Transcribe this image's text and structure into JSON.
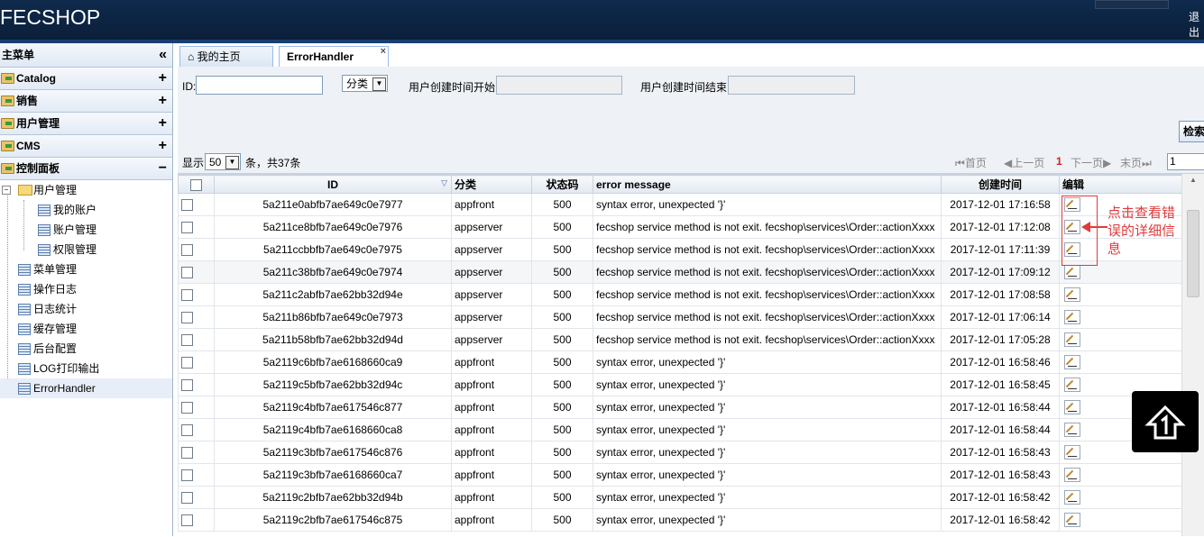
{
  "header": {
    "logo": "FECSHOP",
    "logout": "退出"
  },
  "sidebar": {
    "title": "主菜单",
    "menus": [
      {
        "label": "Catalog",
        "toggle": "+"
      },
      {
        "label": "销售",
        "toggle": "+"
      },
      {
        "label": "用户管理",
        "toggle": "+"
      },
      {
        "label": "CMS",
        "toggle": "+"
      },
      {
        "label": "控制面板",
        "toggle": "−"
      }
    ],
    "tree": {
      "group": "用户管理",
      "children": [
        "我的账户",
        "账户管理",
        "权限管理"
      ],
      "items": [
        "菜单管理",
        "操作日志",
        "日志统计",
        "缓存管理",
        "后台配置",
        "LOG打印输出",
        "ErrorHandler"
      ]
    }
  },
  "tabs": [
    {
      "label": "我的主页"
    },
    {
      "label": "ErrorHandler",
      "close": "×"
    }
  ],
  "search": {
    "id_label": "ID:",
    "category_label": "分类",
    "start_label": "用户创建时间开始",
    "end_label": "用户创建时间结束",
    "search_button": "检索"
  },
  "pager": {
    "show": "显示",
    "per_page": "50",
    "summary": "条，共37条",
    "first": "首页",
    "prev": "上一页",
    "current": "1",
    "next": "下一页",
    "last": "末页",
    "page_input": "1"
  },
  "table": {
    "columns": [
      "ID",
      "分类",
      "状态码",
      "error message",
      "创建时间",
      "编辑"
    ],
    "rows": [
      [
        "5a211e0abfb7ae649c0e7977",
        "appfront",
        "500",
        "syntax error, unexpected '}'",
        "2017-12-01 17:16:58"
      ],
      [
        "5a211ce8bfb7ae649c0e7976",
        "appserver",
        "500",
        "fecshop service method is not exit. fecshop\\services\\Order::actionXxxx",
        "2017-12-01 17:12:08"
      ],
      [
        "5a211ccbbfb7ae649c0e7975",
        "appserver",
        "500",
        "fecshop service method is not exit. fecshop\\services\\Order::actionXxxx",
        "2017-12-01 17:11:39"
      ],
      [
        "5a211c38bfb7ae649c0e7974",
        "appserver",
        "500",
        "fecshop service method is not exit. fecshop\\services\\Order::actionXxxx",
        "2017-12-01 17:09:12"
      ],
      [
        "5a211c2abfb7ae62bb32d94e",
        "appserver",
        "500",
        "fecshop service method is not exit. fecshop\\services\\Order::actionXxxx",
        "2017-12-01 17:08:58"
      ],
      [
        "5a211b86bfb7ae649c0e7973",
        "appserver",
        "500",
        "fecshop service method is not exit. fecshop\\services\\Order::actionXxxx",
        "2017-12-01 17:06:14"
      ],
      [
        "5a211b58bfb7ae62bb32d94d",
        "appserver",
        "500",
        "fecshop service method is not exit. fecshop\\services\\Order::actionXxxx",
        "2017-12-01 17:05:28"
      ],
      [
        "5a2119c6bfb7ae6168660ca9",
        "appfront",
        "500",
        "syntax error, unexpected '}'",
        "2017-12-01 16:58:46"
      ],
      [
        "5a2119c5bfb7ae62bb32d94c",
        "appfront",
        "500",
        "syntax error, unexpected '}'",
        "2017-12-01 16:58:45"
      ],
      [
        "5a2119c4bfb7ae617546c877",
        "appfront",
        "500",
        "syntax error, unexpected '}'",
        "2017-12-01 16:58:44"
      ],
      [
        "5a2119c4bfb7ae6168660ca8",
        "appfront",
        "500",
        "syntax error, unexpected '}'",
        "2017-12-01 16:58:44"
      ],
      [
        "5a2119c3bfb7ae617546c876",
        "appfront",
        "500",
        "syntax error, unexpected '}'",
        "2017-12-01 16:58:43"
      ],
      [
        "5a2119c3bfb7ae6168660ca7",
        "appfront",
        "500",
        "syntax error, unexpected '}'",
        "2017-12-01 16:58:43"
      ],
      [
        "5a2119c2bfb7ae62bb32d94b",
        "appfront",
        "500",
        "syntax error, unexpected '}'",
        "2017-12-01 16:58:42"
      ],
      [
        "5a2119c2bfb7ae617546c875",
        "appfront",
        "500",
        "syntax error, unexpected '}'",
        "2017-12-01 16:58:42"
      ]
    ]
  },
  "annotation": {
    "text": "点击查看错误的详细信息",
    "color": "#e03a3a"
  },
  "icons": {
    "edit": "pencil-edit-icon",
    "to_top": "back-to-top-icon",
    "home": "home-icon"
  }
}
